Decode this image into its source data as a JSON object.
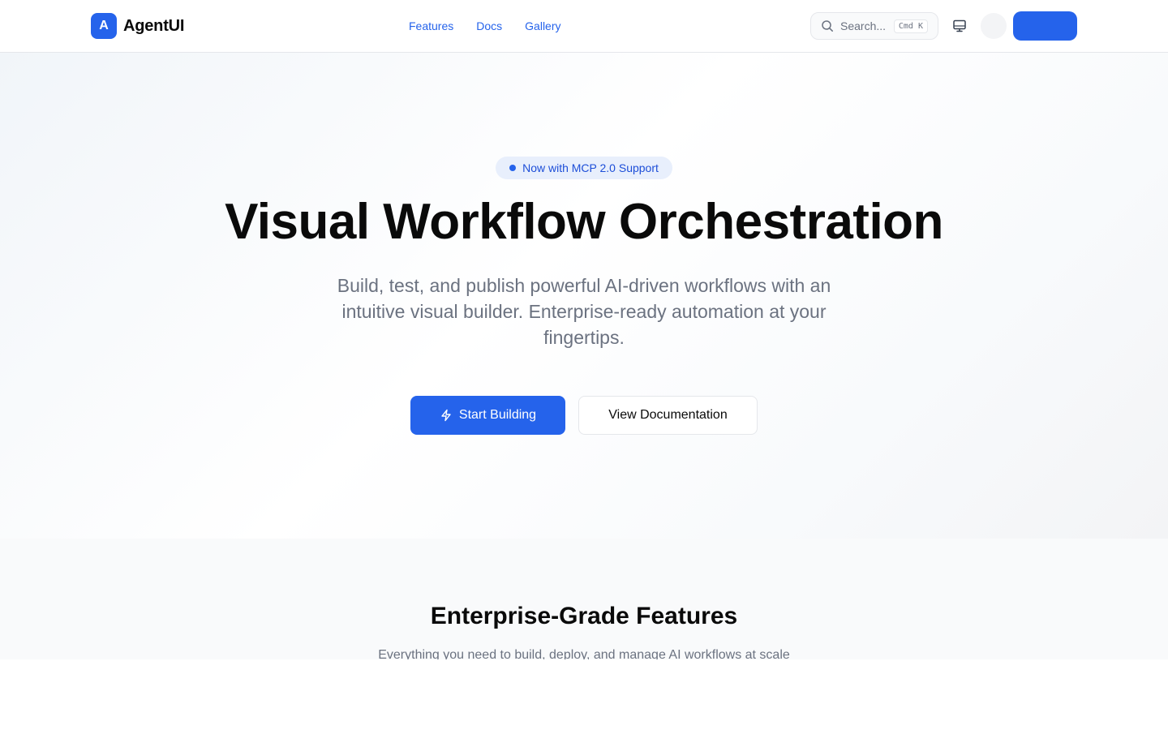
{
  "header": {
    "brand": {
      "mark": "A",
      "name": "AgentUI"
    },
    "nav": [
      {
        "label": "Features"
      },
      {
        "label": "Docs"
      },
      {
        "label": "Gallery"
      }
    ],
    "search": {
      "placeholder": "Search...",
      "shortcut": "Cmd K",
      "icon": "search-icon"
    },
    "icons": {
      "display": "monitor-icon"
    },
    "cta_label": ""
  },
  "hero": {
    "badge": "Now with MCP 2.0 Support",
    "title": "Visual Workflow Orchestration",
    "subtitle": "Build, test, and publish powerful AI-driven workflows with an intuitive visual builder. Enterprise-ready automation at your fingertips.",
    "primary_button": {
      "label": "Start Building",
      "icon": "lightning-icon"
    },
    "secondary_button": {
      "label": "View Documentation"
    }
  },
  "features": {
    "title": "Enterprise-Grade Features",
    "subtitle": "Everything you need to build, deploy, and manage AI workflows at scale"
  },
  "colors": {
    "accent": "#2563eb",
    "badge_bg": "#e8effc",
    "muted_text": "#6b7280",
    "border": "#e5e7eb"
  }
}
